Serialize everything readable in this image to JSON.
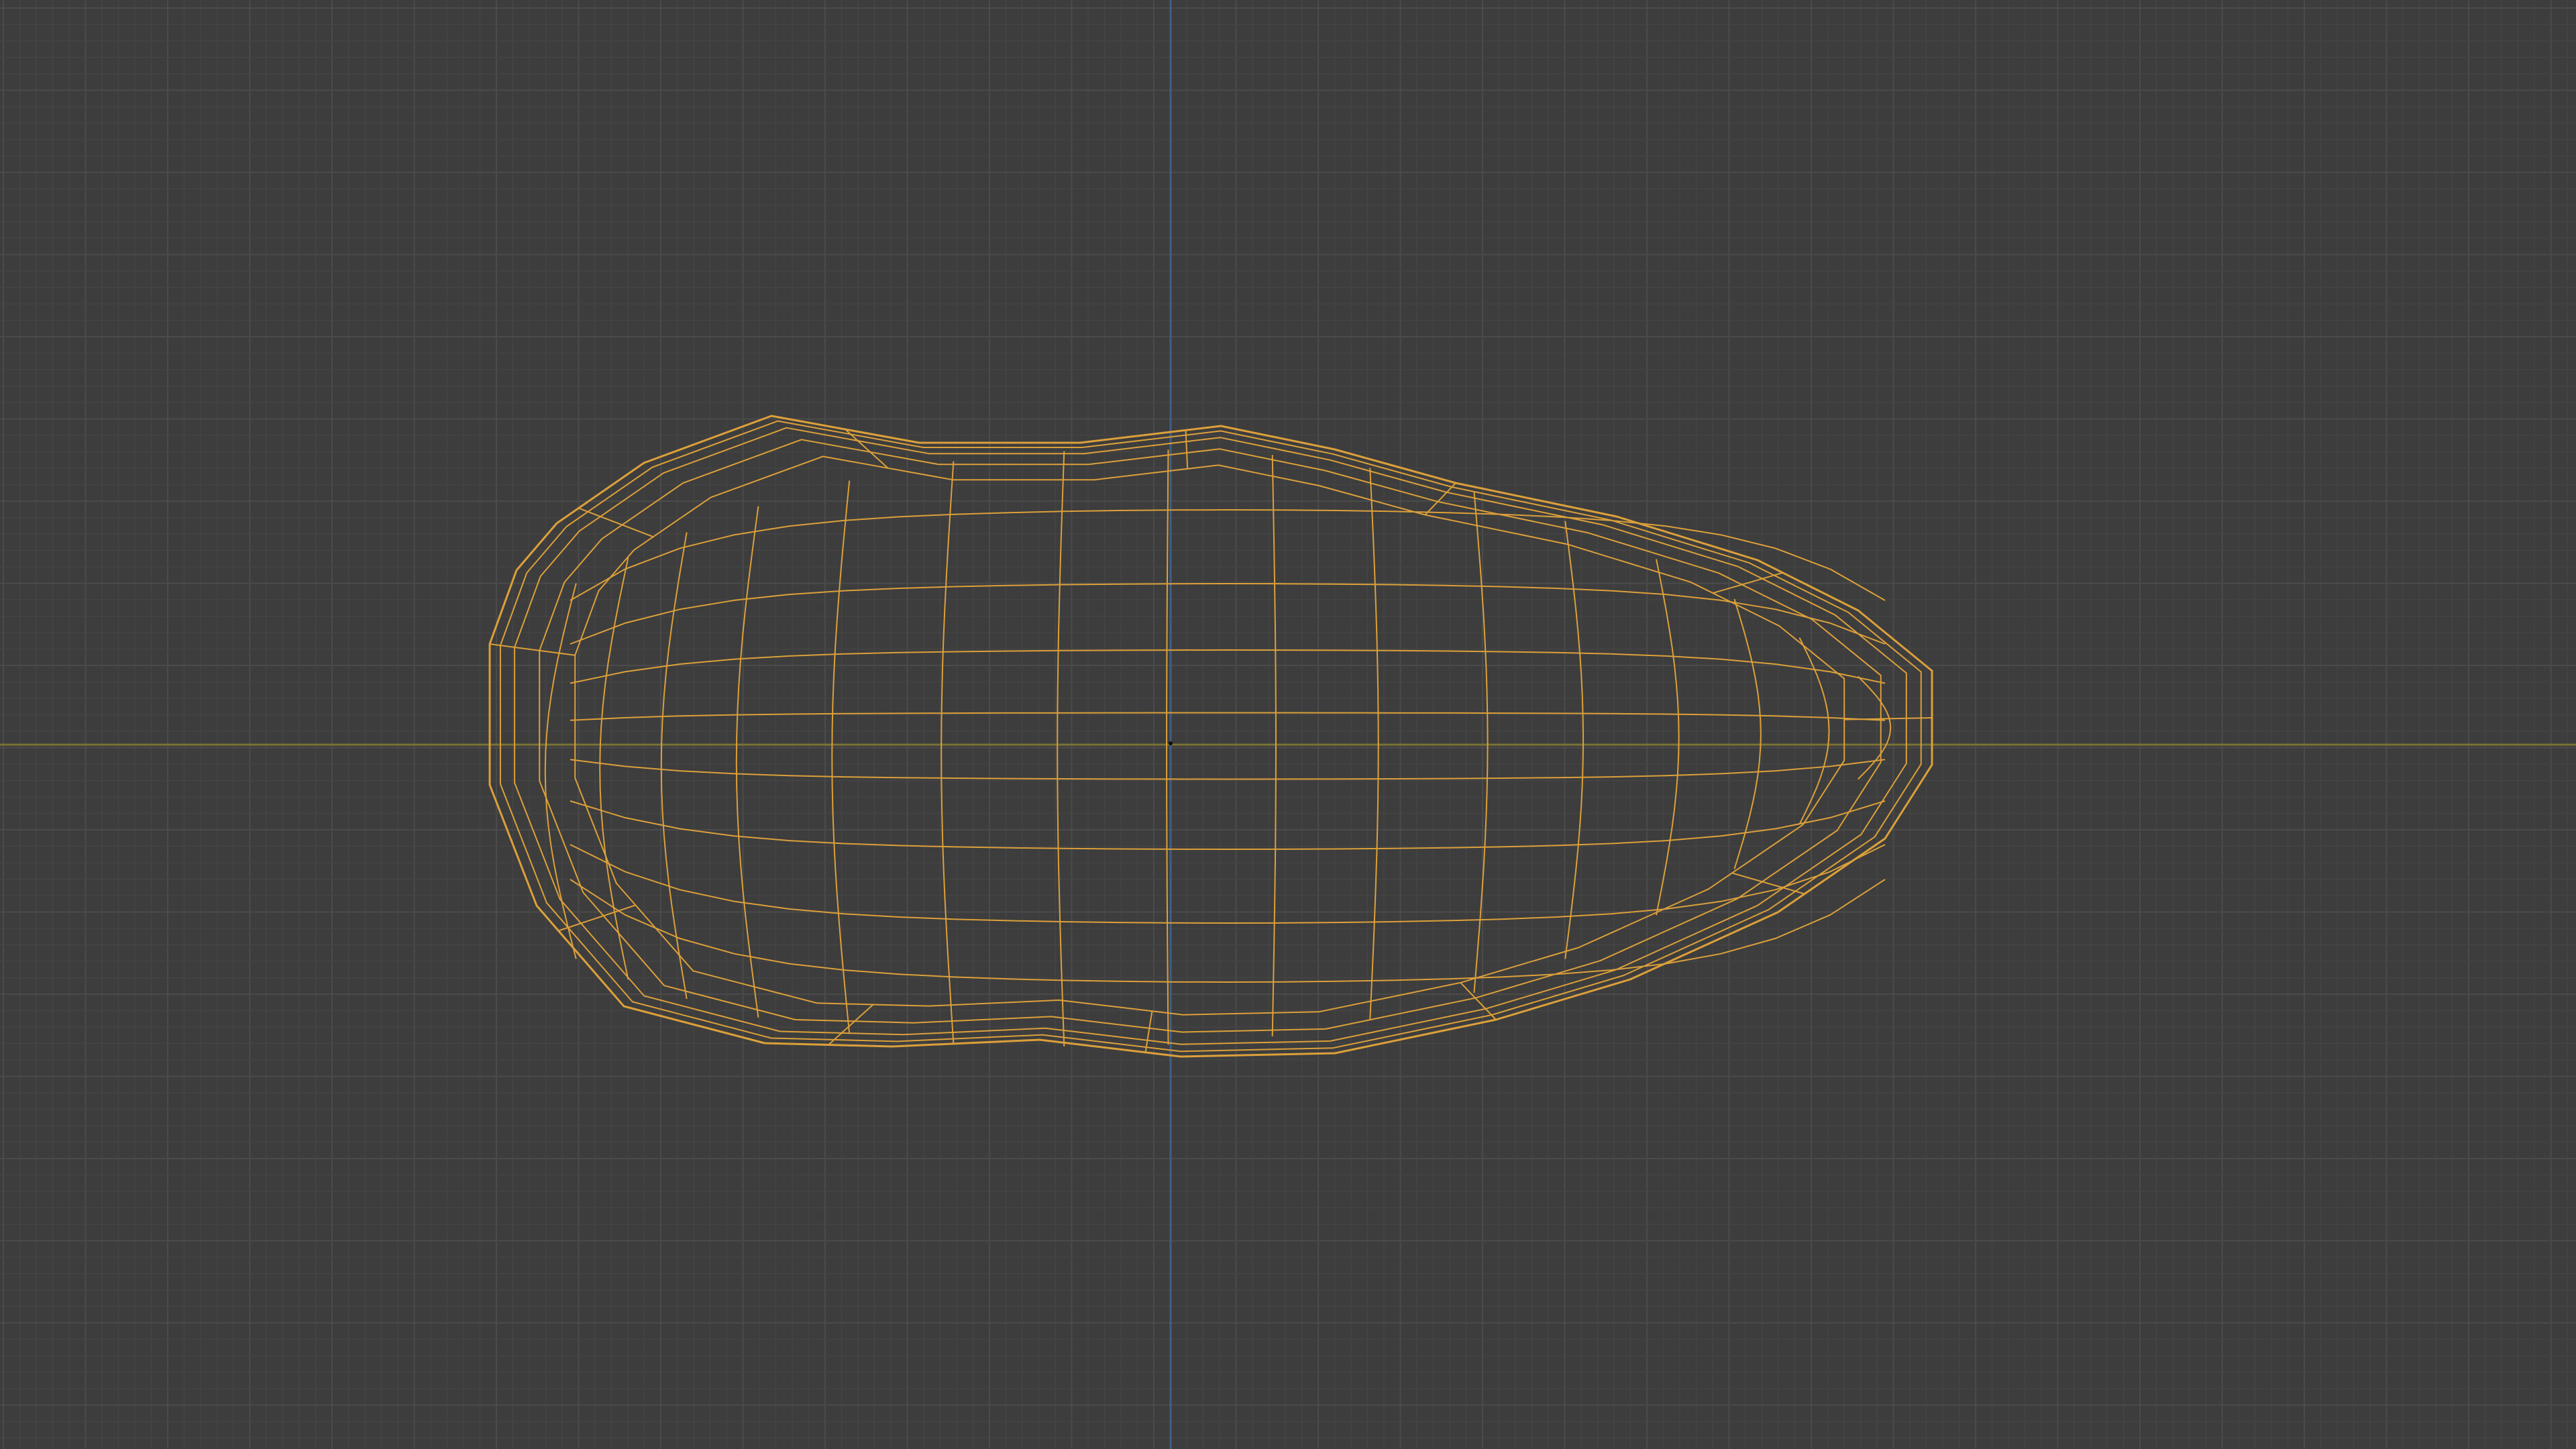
{
  "viewport": {
    "background": "#3d3d3d",
    "grid_minor_color": "#454545",
    "grid_major_color": "#4b4b4b",
    "x_axis_color": "#7c7233",
    "y_axis_color": "#3f5f86",
    "wire_color": "#dca03a",
    "grid_visible": true,
    "mesh_selected": true
  }
}
